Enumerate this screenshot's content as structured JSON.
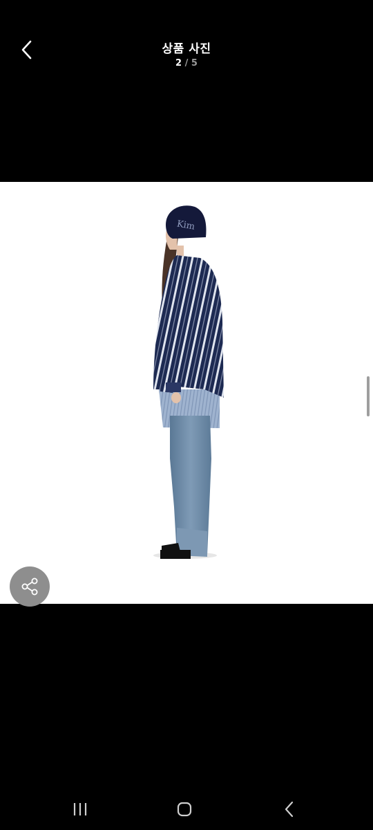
{
  "header": {
    "title": "상품 사진",
    "counter_current": "2",
    "counter_separator": "/",
    "counter_total": "5",
    "back_icon": "chevron-left-icon"
  },
  "photo": {
    "beanie_text": "Kim",
    "background": "#ffffff"
  },
  "share": {
    "icon": "share-icon",
    "background": "#8e8e8e"
  },
  "system_nav": {
    "recents_icon": "recent-apps-icon",
    "home_icon": "home-icon",
    "back_icon": "back-icon"
  }
}
